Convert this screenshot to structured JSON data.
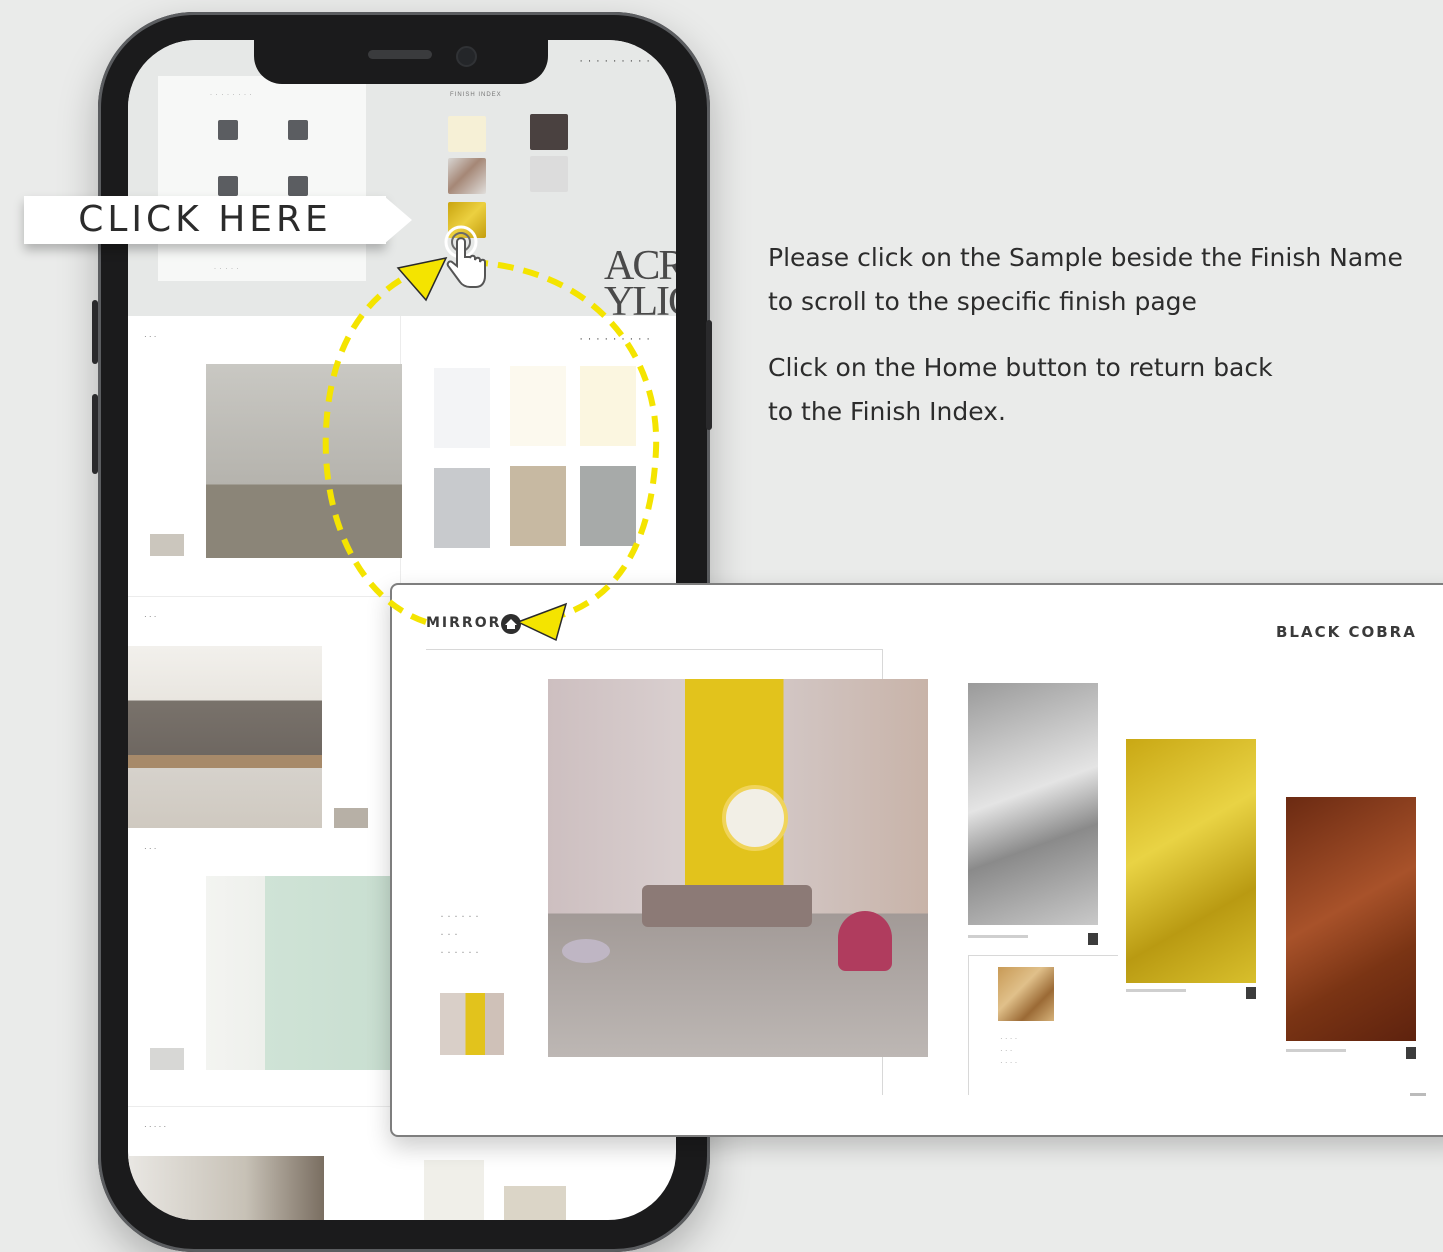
{
  "callout": {
    "click_here": "CLICK HERE"
  },
  "instructions": {
    "line1": "Please click on the Sample beside the Finish Name",
    "line2": "to scroll to the specific finish page",
    "line3": "Click on the Home button to return back",
    "line4": "to the Finish Index."
  },
  "phone": {
    "index_page": {
      "finish_index_title": "FINISH INDEX",
      "acrylic_word": "ACR YLIC"
    }
  },
  "popup": {
    "section_title": "MIRROR",
    "brand": "BLACK COBRA",
    "finishes": [
      {
        "name": "silver",
        "color": "#c9c9c9"
      },
      {
        "name": "gold",
        "color": "#e0c12a"
      },
      {
        "name": "copper",
        "color": "#8a3e1a"
      }
    ]
  },
  "colors": {
    "background": "#eaebea",
    "arrow": "#f4e400",
    "phone_frame": "#1b1b1c"
  }
}
